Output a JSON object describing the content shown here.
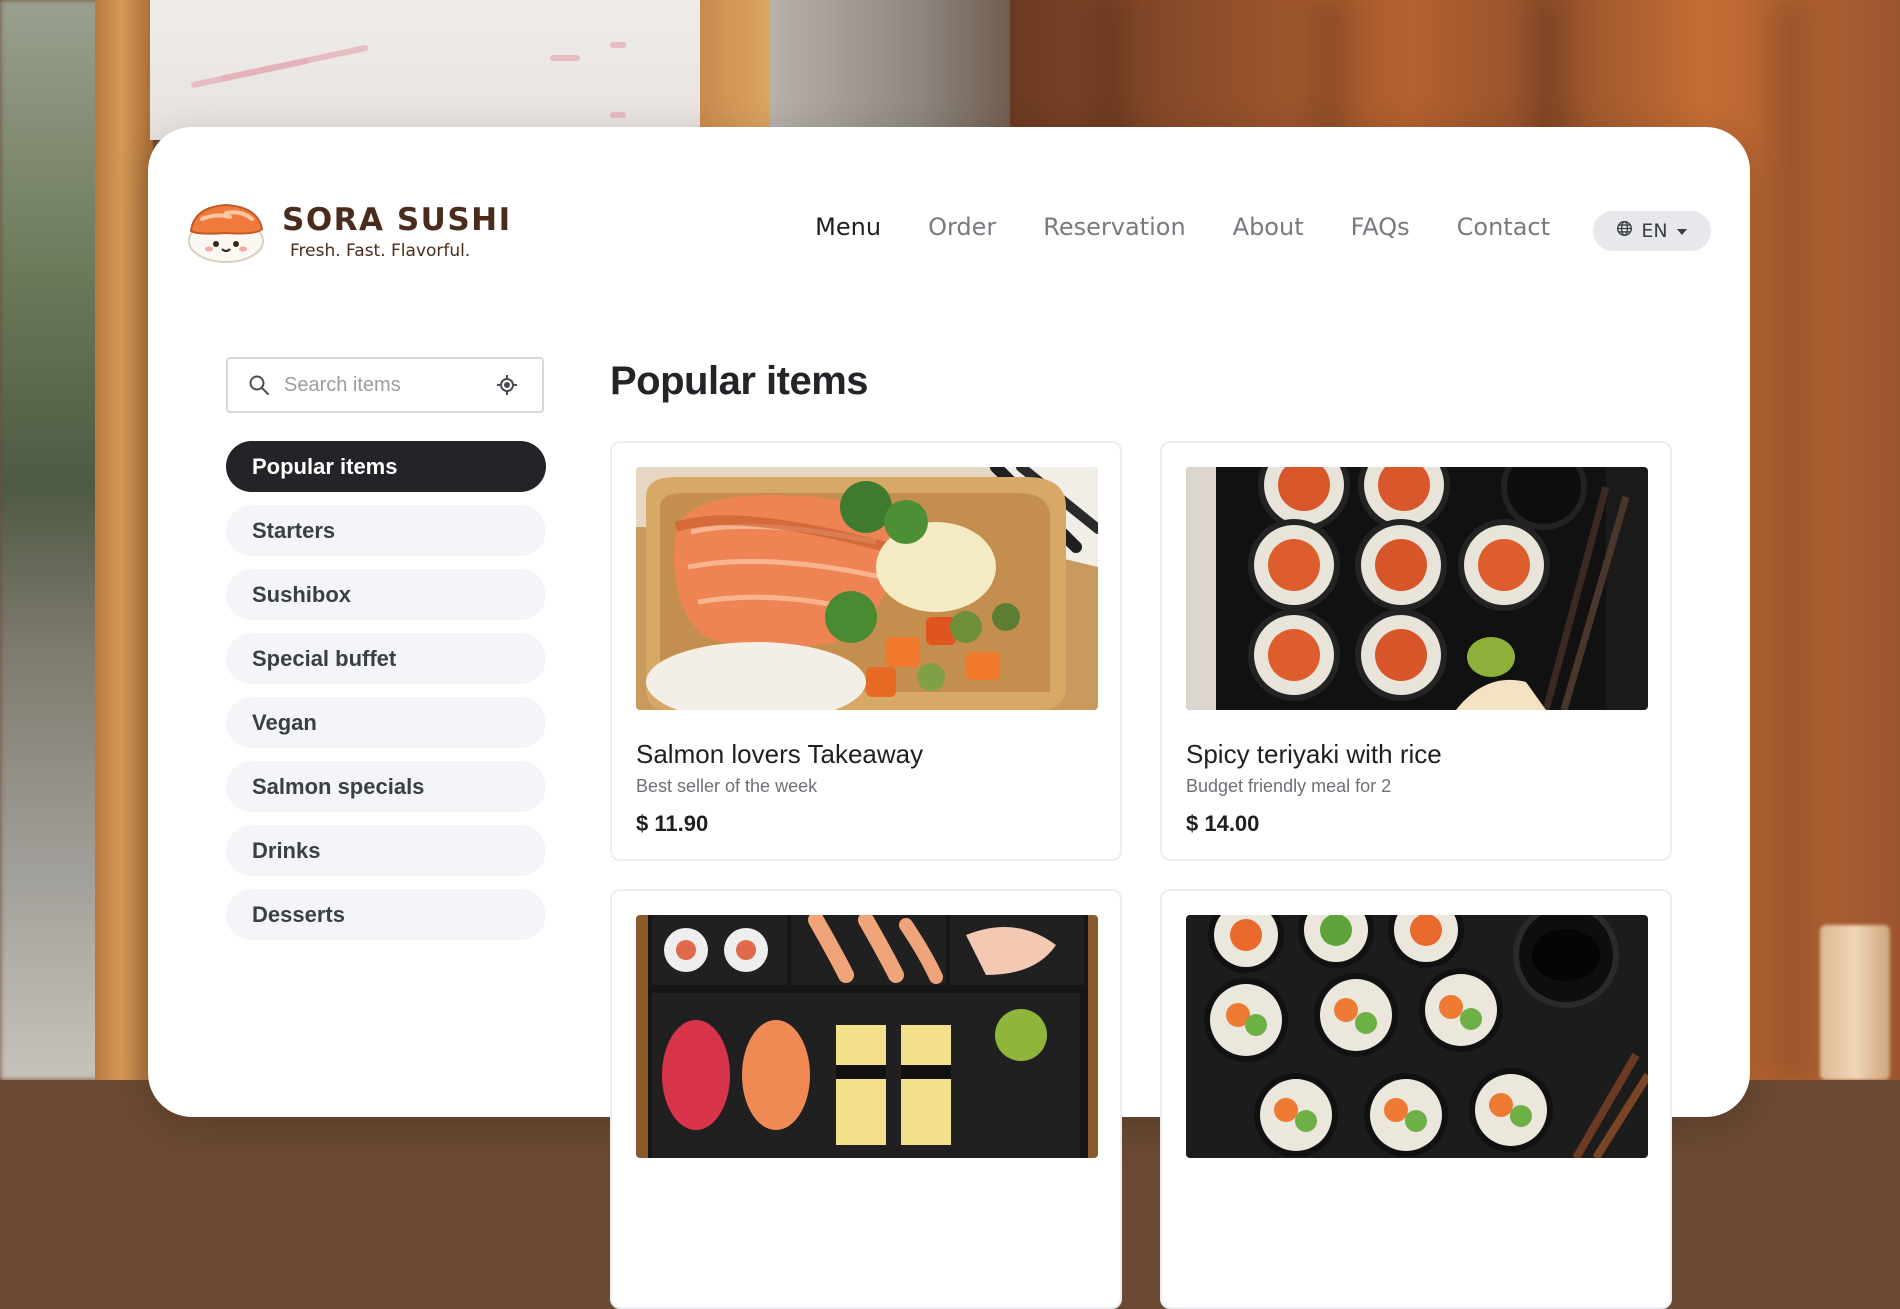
{
  "brand": {
    "name": "SORA SUSHI",
    "tagline": "Fresh. Fast. Flavorful."
  },
  "nav": {
    "items": [
      {
        "label": "Menu",
        "active": true
      },
      {
        "label": "Order"
      },
      {
        "label": "Reservation"
      },
      {
        "label": "About"
      },
      {
        "label": "FAQs"
      },
      {
        "label": "Contact"
      }
    ]
  },
  "language": {
    "code": "EN",
    "icon": "globe-icon"
  },
  "search": {
    "placeholder": "Search items",
    "icon": "search-icon",
    "action_icon": "locate-icon"
  },
  "categories": [
    {
      "label": "Popular items",
      "active": true
    },
    {
      "label": "Starters"
    },
    {
      "label": "Sushibox"
    },
    {
      "label": "Special buffet"
    },
    {
      "label": "Vegan"
    },
    {
      "label": "Salmon specials"
    },
    {
      "label": "Drinks"
    },
    {
      "label": "Desserts"
    }
  ],
  "section": {
    "title": "Popular items"
  },
  "items": [
    {
      "name": "Salmon lovers Takeaway",
      "description": "Best seller of the week",
      "price": "$ 11.90",
      "image": "salmon-bowl-photo"
    },
    {
      "name": "Spicy teriyaki with rice",
      "description": "Budget friendly meal for 2",
      "price": "$ 14.00",
      "image": "spicy-maki-photo"
    },
    {
      "image": "sushi-box-photo"
    },
    {
      "image": "veggie-maki-photo"
    }
  ],
  "colors": {
    "brand": "#4a2c1c",
    "active_bg": "#222428",
    "accent_salmon": "#f07a3c"
  }
}
